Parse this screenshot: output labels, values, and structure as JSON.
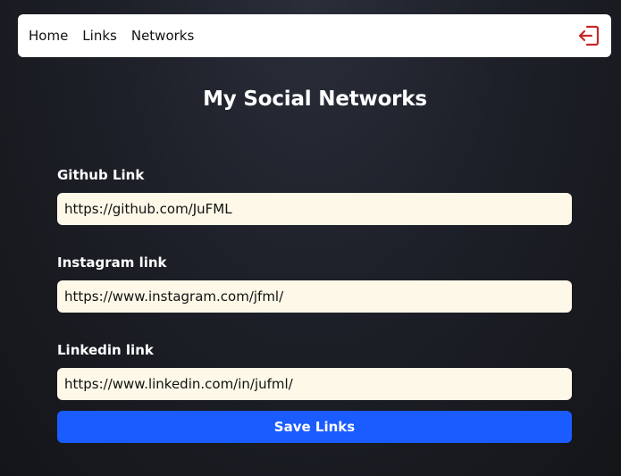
{
  "nav": {
    "items": [
      {
        "label": "Home"
      },
      {
        "label": "Links"
      },
      {
        "label": "Networks"
      }
    ],
    "logout_icon": "logout-icon",
    "logout_color": "#c62828"
  },
  "page": {
    "title": "My Social Networks"
  },
  "form": {
    "github": {
      "label": "Github Link",
      "value": "https://github.com/JuFML"
    },
    "instagram": {
      "label": "Instagram link",
      "value": "https://www.instagram.com/jfml/"
    },
    "linkedin": {
      "label": "Linkedin link",
      "value": "https://www.linkedin.com/in/jufml/"
    },
    "save_label": "Save Links"
  },
  "colors": {
    "accent": "#1a5cff",
    "input_bg": "#fdf8e8"
  }
}
